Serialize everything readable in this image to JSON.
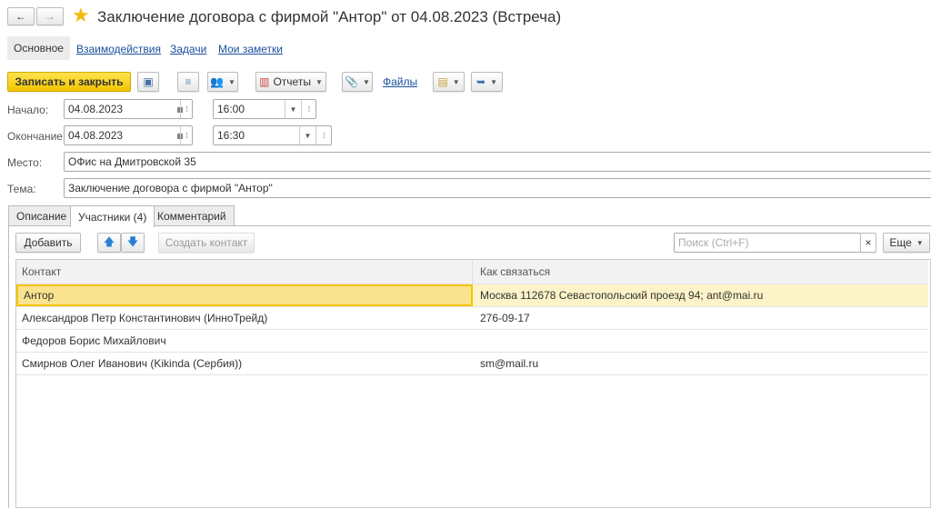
{
  "title": "Заключение договора с фирмой \"Антор\" от 04.08.2023 (Встреча)",
  "nav": {
    "back": "←",
    "forward": "→"
  },
  "sections": [
    "Основное",
    "Взаимодействия",
    "Задачи",
    "Мои заметки"
  ],
  "toolbar": {
    "save_close": "Записать и закрыть",
    "reports": "Отчеты",
    "files": "Файлы"
  },
  "fields": {
    "start_label": "Начало:",
    "start_date": "04.08.2023",
    "start_time": "16:00",
    "end_label": "Окончание:",
    "end_date": "04.08.2023",
    "end_time": "16:30",
    "place_label": "Место:",
    "place": "ОФис на Дмитровской 35",
    "subject_label": "Тема:",
    "subject": "Заключение договора с фирмой \"Антор\""
  },
  "tabs": [
    "Описание",
    "Участники (4)",
    "Комментарий"
  ],
  "participants": {
    "add": "Добавить",
    "create_contact": "Создать контакт",
    "search_placeholder": "Поиск (Ctrl+F)",
    "clear": "×",
    "more": "Еще",
    "columns": [
      "Контакт",
      "Как связаться"
    ],
    "rows": [
      {
        "contact": "Антор",
        "how": "Москва 112678 Севастопольский проезд 94; ant@mai.ru"
      },
      {
        "contact": "Александров Петр Константинович (ИнноТрейд)",
        "how": "276-09-17"
      },
      {
        "contact": "Федоров Борис Михайлович",
        "how": ""
      },
      {
        "contact": "Смирнов Олег Иванович (Kikinda (Сербия))",
        "how": "sm@mail.ru"
      }
    ]
  }
}
